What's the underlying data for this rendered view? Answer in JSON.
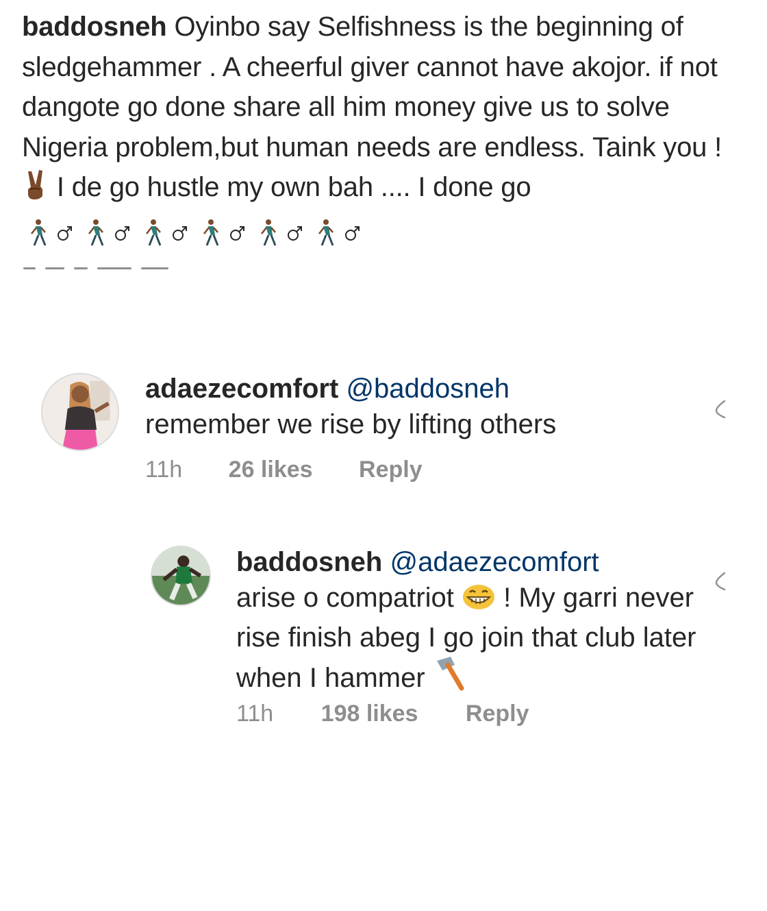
{
  "post": {
    "username": "baddosneh",
    "caption_part1": "Oyinbo say Selfishness is the beginning of sledgehammer . A cheerful giver cannot have akojor. if not dangote go done share all him money give us to solve Nigeria problem,but human needs are endless. Taink you !",
    "caption_part2": "I de go hustle my own bah .... I done go",
    "emoji_victory": "victory-hand-icon",
    "emoji_walkers": "man-walking-icon"
  },
  "comments": [
    {
      "username": "adaezecomfort",
      "mention": "@baddosneh",
      "text": "remember we rise by lifting others",
      "time": "11h",
      "likes": "26 likes",
      "reply_label": "Reply",
      "like_icon": "heart-icon"
    }
  ],
  "replies": [
    {
      "username": "baddosneh",
      "mention": "@adaezecomfort",
      "text_part1": "arise o compatriot",
      "text_part2": "! My garri never rise finish abeg I go join that club later when I hammer",
      "emoji_grin": "grinning-face-icon",
      "emoji_hammer": "hammer-icon",
      "time": "11h",
      "likes": "198 likes",
      "reply_label": "Reply",
      "like_icon": "heart-icon"
    }
  ],
  "colors": {
    "text": "#262626",
    "secondary": "#8e8e8e",
    "mention": "#003569"
  }
}
